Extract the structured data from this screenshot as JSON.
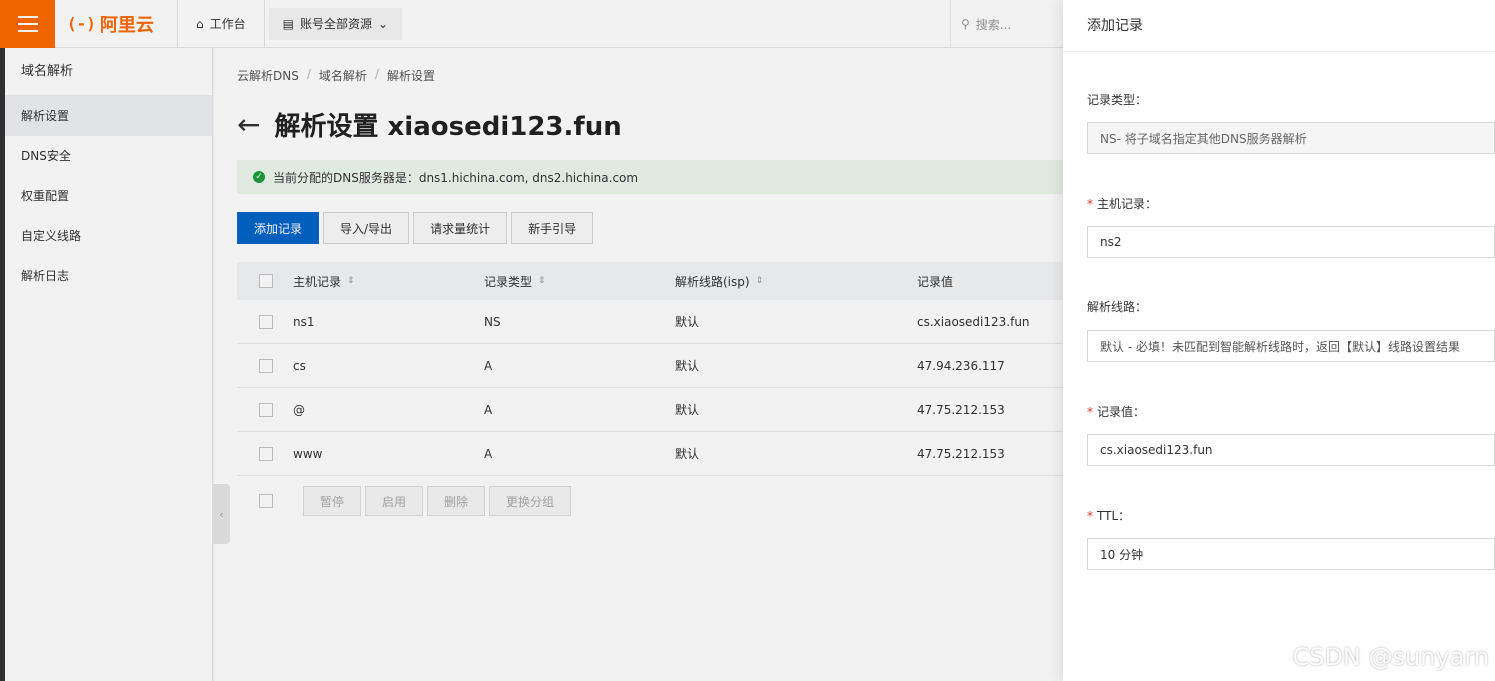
{
  "topbar": {
    "brand": "阿里云",
    "brand_mark": "(-)",
    "workbench": "工作台",
    "resources": "账号全部资源",
    "search_placeholder": "搜索..."
  },
  "sidebar": {
    "title": "域名解析",
    "items": [
      {
        "label": "解析设置"
      },
      {
        "label": "DNS安全"
      },
      {
        "label": "权重配置"
      },
      {
        "label": "自定义线路"
      },
      {
        "label": "解析日志"
      }
    ]
  },
  "breadcrumb": [
    "云解析DNS",
    "域名解析",
    "解析设置"
  ],
  "page": {
    "title": "解析设置 xiaosedi123.fun",
    "notice": "当前分配的DNS服务器是：dns1.hichina.com, dns2.hichina.com"
  },
  "toolbar": {
    "add": "添加记录",
    "import_export": "导入/导出",
    "stats": "请求量统计",
    "guide": "新手引导"
  },
  "table": {
    "headers": [
      "主机记录",
      "记录类型",
      "解析线路(isp)",
      "记录值"
    ],
    "rows": [
      [
        "ns1",
        "NS",
        "默认",
        "cs.xiaosedi123.fun"
      ],
      [
        "cs",
        "A",
        "默认",
        "47.94.236.117"
      ],
      [
        "@",
        "A",
        "默认",
        "47.75.212.153"
      ],
      [
        "www",
        "A",
        "默认",
        "47.75.212.153"
      ]
    ]
  },
  "bulk_actions": [
    "暂停",
    "启用",
    "删除",
    "更换分组"
  ],
  "drawer": {
    "title": "添加记录",
    "record_type_label": "记录类型：",
    "record_type_value": "NS- 将子域名指定其他DNS服务器解析",
    "host_label": "主机记录：",
    "host_value": "ns2",
    "line_label": "解析线路：",
    "line_value": "默认 - 必填！未匹配到智能解析线路时，返回【默认】线路设置结果",
    "value_label": "记录值：",
    "value_value": "cs.xiaosedi123.fun",
    "ttl_label": "TTL：",
    "ttl_value": "10 分钟"
  },
  "watermark": "CSDN @sunyarn",
  "colors": {
    "accent": "#ff6a00",
    "primary": "#0064c8",
    "required": "#d93026"
  }
}
